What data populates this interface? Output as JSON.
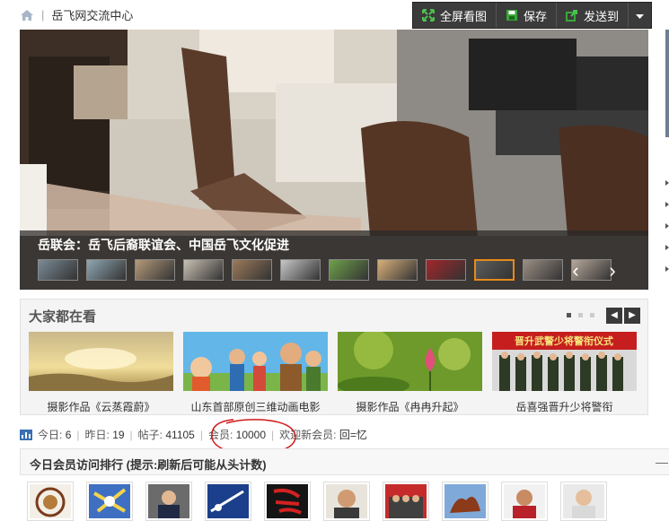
{
  "topbar": {
    "breadcrumb_title": "岳飞网交流中心",
    "buttons": {
      "fullscreen": "全屏看图",
      "save": "保存",
      "send": "发送到"
    }
  },
  "slideshow": {
    "caption": "岳联会：岳飞后裔联谊会、中国岳飞文化促进",
    "thumb_count": 12,
    "active_thumb": 9
  },
  "popular": {
    "title": "大家都在看",
    "items": [
      {
        "label": "摄影作品《云蒸霞蔚》"
      },
      {
        "label": "山东首部原创三维动画电影"
      },
      {
        "label": "摄影作品《冉冉升起》"
      },
      {
        "label": "岳喜强晋升少将警衔"
      }
    ],
    "banner_text": "晋升武警少将警衔仪式"
  },
  "stats": {
    "today_label": "今日:",
    "today_value": "6",
    "yesterday_label": "昨日:",
    "yesterday_value": "19",
    "posts_label": "帖子:",
    "posts_value": "41105",
    "members_label": "会员:",
    "members_value": "10000",
    "welcome_label": "欢迎新会员:",
    "welcome_value": "回=忆"
  },
  "ranking": {
    "title": "今日会员访问排行 (提示:刷新后可能从头计数)",
    "toggle": "—"
  },
  "colors": {
    "accent_active_thumb": "#e88a1a",
    "toolbar_bg": "#3b3b3b",
    "annotation_red": "#d01818"
  }
}
